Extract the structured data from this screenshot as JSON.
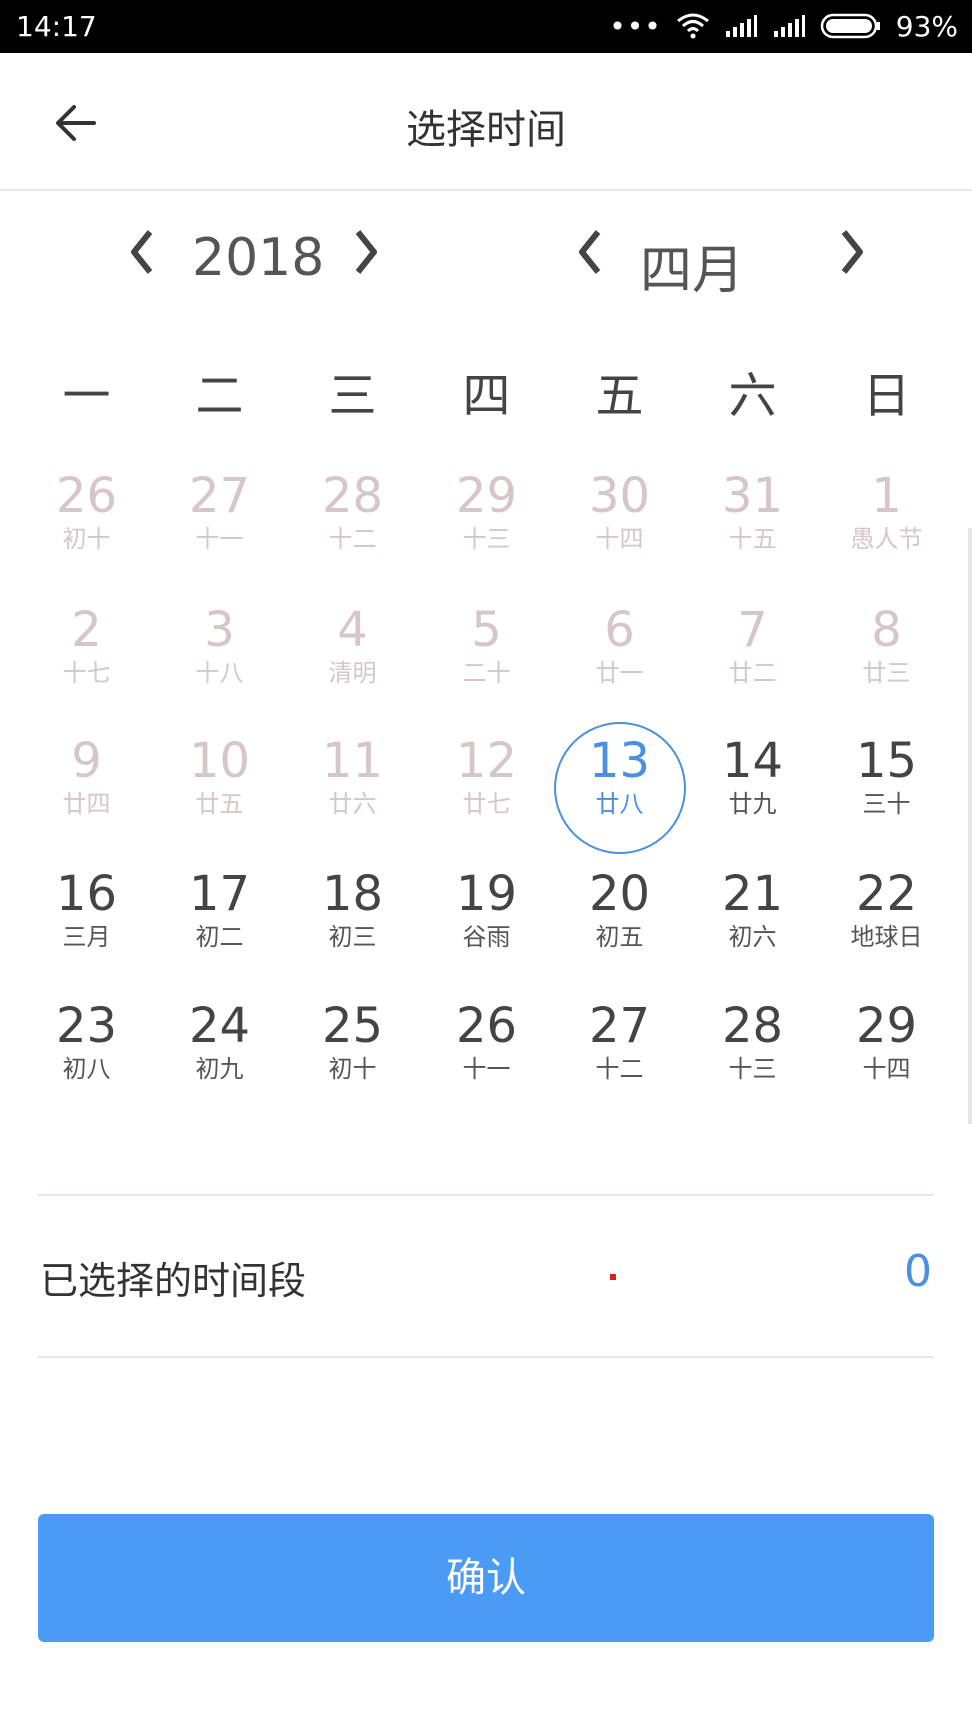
{
  "status_bar": {
    "time": "14:17",
    "battery": "93%",
    "icons": [
      "more-dots-icon",
      "wifi-icon",
      "signal-icon",
      "signal-icon",
      "battery-icon"
    ]
  },
  "header": {
    "title": "选择时间"
  },
  "nav": {
    "year": "2018",
    "month": "四月"
  },
  "calendar": {
    "weekdays": [
      "一",
      "二",
      "三",
      "四",
      "五",
      "六",
      "日"
    ],
    "weeks": [
      [
        {
          "day": "26",
          "lunar": "初十",
          "state": "muted"
        },
        {
          "day": "27",
          "lunar": "十一",
          "state": "muted"
        },
        {
          "day": "28",
          "lunar": "十二",
          "state": "muted"
        },
        {
          "day": "29",
          "lunar": "十三",
          "state": "muted"
        },
        {
          "day": "30",
          "lunar": "十四",
          "state": "muted"
        },
        {
          "day": "31",
          "lunar": "十五",
          "state": "muted"
        },
        {
          "day": "1",
          "lunar": "愚人节",
          "state": "muted"
        }
      ],
      [
        {
          "day": "2",
          "lunar": "十七",
          "state": "muted"
        },
        {
          "day": "3",
          "lunar": "十八",
          "state": "muted"
        },
        {
          "day": "4",
          "lunar": "清明",
          "state": "muted"
        },
        {
          "day": "5",
          "lunar": "二十",
          "state": "muted"
        },
        {
          "day": "6",
          "lunar": "廿一",
          "state": "muted"
        },
        {
          "day": "7",
          "lunar": "廿二",
          "state": "muted"
        },
        {
          "day": "8",
          "lunar": "廿三",
          "state": "muted"
        }
      ],
      [
        {
          "day": "9",
          "lunar": "廿四",
          "state": "muted"
        },
        {
          "day": "10",
          "lunar": "廿五",
          "state": "muted"
        },
        {
          "day": "11",
          "lunar": "廿六",
          "state": "muted"
        },
        {
          "day": "12",
          "lunar": "廿七",
          "state": "muted"
        },
        {
          "day": "13",
          "lunar": "廿八",
          "state": "selected"
        },
        {
          "day": "14",
          "lunar": "廿九",
          "state": "active"
        },
        {
          "day": "15",
          "lunar": "三十",
          "state": "active"
        }
      ],
      [
        {
          "day": "16",
          "lunar": "三月",
          "state": "active"
        },
        {
          "day": "17",
          "lunar": "初二",
          "state": "active"
        },
        {
          "day": "18",
          "lunar": "初三",
          "state": "active"
        },
        {
          "day": "19",
          "lunar": "谷雨",
          "state": "active"
        },
        {
          "day": "20",
          "lunar": "初五",
          "state": "active"
        },
        {
          "day": "21",
          "lunar": "初六",
          "state": "active"
        },
        {
          "day": "22",
          "lunar": "地球日",
          "state": "active"
        }
      ],
      [
        {
          "day": "23",
          "lunar": "初八",
          "state": "active"
        },
        {
          "day": "24",
          "lunar": "初九",
          "state": "active"
        },
        {
          "day": "25",
          "lunar": "初十",
          "state": "active"
        },
        {
          "day": "26",
          "lunar": "十一",
          "state": "active"
        },
        {
          "day": "27",
          "lunar": "十二",
          "state": "active"
        },
        {
          "day": "28",
          "lunar": "十三",
          "state": "active"
        },
        {
          "day": "29",
          "lunar": "十四",
          "state": "active"
        }
      ]
    ]
  },
  "selection": {
    "label": "已选择的时间段",
    "count": "0"
  },
  "confirm": {
    "label": "确认"
  },
  "colors": {
    "accent": "#4a90e2",
    "button": "#4a9bf6",
    "muted_text": "#d6c6c8",
    "divider": "#f1e4e6",
    "dot": "#d9211b"
  }
}
